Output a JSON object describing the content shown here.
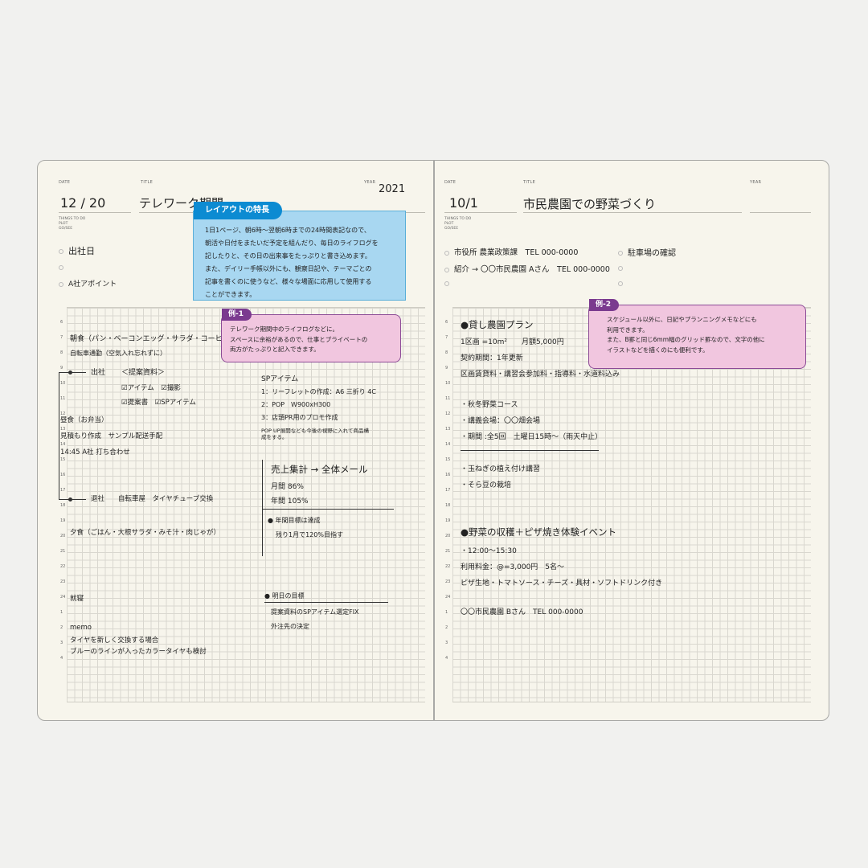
{
  "left": {
    "date_label": "DATE",
    "title_label": "TITLE",
    "year_label": "YEAR",
    "todo_label": [
      "THINGS TO DO",
      "PLOT",
      "GO/SEE"
    ],
    "date": "12 / 20",
    "title": "テレワーク期間",
    "year": "2021",
    "todos": [
      "出社日",
      "",
      "A社アポイント"
    ],
    "hours": [
      "6",
      "7",
      "8",
      "9",
      "10",
      "11",
      "12",
      "13",
      "14",
      "15",
      "16",
      "17",
      "18",
      "19",
      "20",
      "21",
      "22",
      "23",
      "24",
      "1",
      "2",
      "3",
      "4"
    ],
    "entries": {
      "breakfast": "朝食（パン・ベーコンエッグ・サラダ・コーヒー）",
      "commute": "自転車通勤（空気入れ忘れずに）",
      "go_to_office": "出社",
      "proposal_header": "＜提案資料＞",
      "check_items": "☑アイテム　☑撮影",
      "check_docs": "☑提案書　☑SPアイテム",
      "lunch": "昼食（お弁当）",
      "estimate": "見積もり作成　サンプル配送手配",
      "meeting": "14:45 A社 打ち合わせ",
      "leave_office": "退社",
      "bike_shop": "自転車屋　タイヤチューブ交換",
      "dinner": "夕食（ごはん・大根サラダ・みそ汁・肉じゃが）",
      "sleep": "就寝",
      "memo_label": "memo",
      "memo_1": "タイヤを新しく交換する場合",
      "memo_2": "ブルーのラインが入ったカラータイヤも検討"
    },
    "sp_items": {
      "header": "SPアイテム",
      "item_1": "1：リーフレットの作成：A6 三折り 4C",
      "item_2": "2：POP　W900xH300",
      "item_3": "3：店頭PR用のプロモ作成",
      "note": "POP UP展開なども今後の視野に入れて商品構成をする。"
    },
    "sales": {
      "header": "売上集計 → 全体メール",
      "monthly": "月間 86%",
      "yearly": "年間 105%",
      "goal_title": "年間目標は達成",
      "goal_note": "残り1月で120%目指す"
    },
    "tomorrow": {
      "header": "明日の目標",
      "item_1": "提案資料のSPアイテム選定FIX",
      "item_2": "外注先の決定"
    },
    "callout_layout": {
      "tag": "レイアウトの特長",
      "lines": [
        "1日1ページ、朝6時～翌朝6時までの24時間表記なので、",
        "朝活や日付をまたいだ予定を組んだり、毎日のライフログを",
        "記したりと、その日の出来事をたっぷりと書き込めます。",
        "また、デイリー手帳以外にも、観察日記や、テーマごとの",
        "記事を書くのに使うなど、様々な場面に応用して使用する",
        "ことができます。"
      ]
    },
    "callout_ex1": {
      "tag": "例-1",
      "lines": [
        "テレワーク期間中のライフログなどに。",
        "スペースに余裕があるので、仕事とプライベートの",
        "両方がたっぷりと記入できます。"
      ]
    }
  },
  "right": {
    "date_label": "DATE",
    "title_label": "TITLE",
    "year_label": "YEAR",
    "todo_label": [
      "THINGS TO DO",
      "PLOT",
      "GO/SEE"
    ],
    "date": "10/1",
    "title": "市民農園での野菜づくり",
    "year": "",
    "todos_left": [
      "市役所 農業政策課　TEL 000-0000",
      "紹介 → 〇〇市民農園 Aさん　TEL 000-0000",
      ""
    ],
    "todos_right": [
      "駐車場の確認",
      "",
      ""
    ],
    "rental": {
      "header": "●貸し農園プラン",
      "line_1": "1区画 =10m²　　月額5,000円",
      "line_2": "契約期間：1年更新",
      "line_3": "区画賃貸料・講習会参加料・指導料・水道料込み"
    },
    "course": {
      "line_1": "・秋冬野菜コース",
      "line_2": "・講義会場：〇〇畑会場",
      "line_3": "・期間 :全5回　土曜日15時～（雨天中止）",
      "line_4": "・玉ねぎの植え付け講習",
      "line_5": "・そら豆の栽培"
    },
    "event": {
      "header": "●野菜の収穫＋ピザ焼き体験イベント",
      "line_1": "・12:00～15:30",
      "line_2": "利用料金：@=3,000円　5名～",
      "line_3": "ピザ生地・トマトソース・チーズ・具材・ソフトドリンク付き",
      "line_4": "〇〇市民農園 Bさん　TEL 000-0000"
    },
    "callout_ex2": {
      "tag": "例-2",
      "lines": [
        "スケジュール以外に、日記やプランニングメモなどにも",
        "利用できます。",
        "また、B罫と同じ6mm幅のグリッド罫なので、文字の他に",
        "イラストなどを描くのにも便利です。"
      ]
    }
  },
  "colors": {
    "paper": "#f7f5ec",
    "callout_blue": "#a8d7f1",
    "tag_blue": "#0c8bd2",
    "callout_pink": "#f1c6df",
    "tag_purple": "#7b3a8f"
  }
}
